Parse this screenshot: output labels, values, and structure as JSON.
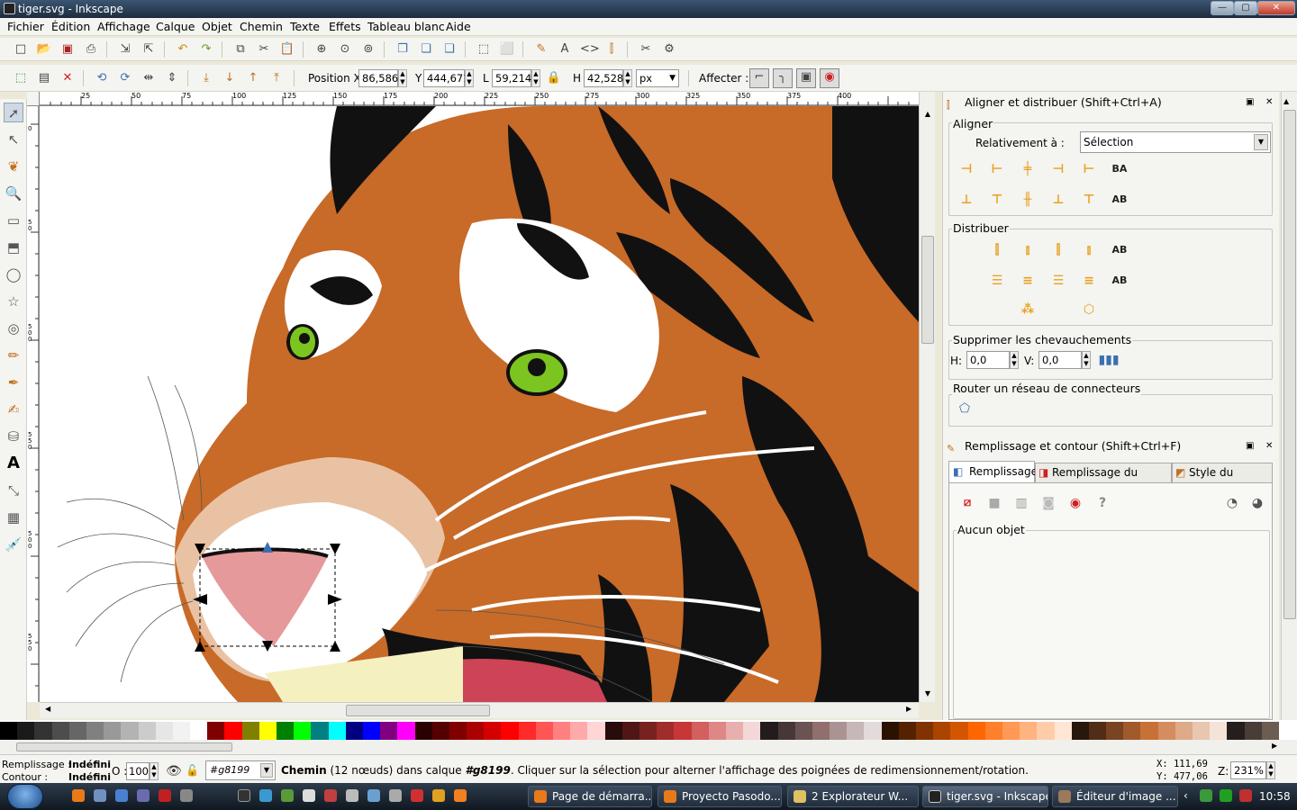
{
  "window": {
    "title": "tiger.svg - Inkscape",
    "minimize": "—",
    "maximize": "▢",
    "close": "✕"
  },
  "menu": [
    "Fichier",
    "Édition",
    "Affichage",
    "Calque",
    "Objet",
    "Chemin",
    "Texte",
    "Effets",
    "Tableau blanc",
    "Aide"
  ],
  "select_toolbar": {
    "x_label": "Position X",
    "x_value": "86,586",
    "y_label": "Y",
    "y_value": "444,671",
    "w_label": "L",
    "w_value": "59,214",
    "h_label": "H",
    "h_value": "42,528",
    "unit": "px",
    "affect_label": "Affecter :"
  },
  "ruler_h": [
    "25",
    "50",
    "75",
    "100",
    "125",
    "150",
    "175",
    "200",
    "225",
    "250",
    "275",
    "300",
    "325",
    "350",
    "375",
    "400"
  ],
  "ruler_v": [
    "0",
    "50",
    "500",
    "550",
    "500",
    "550",
    "500",
    "550"
  ],
  "align_panel": {
    "title": "Aligner et distribuer (Shift+Ctrl+A)",
    "align_label": "Aligner",
    "relative_label": "Relativement à :",
    "relative_value": "Sélection",
    "distribute_label": "Distribuer",
    "overlap_label": "Supprimer les chevauchements",
    "h_label": "H:",
    "h_value": "0,0",
    "v_label": "V:",
    "v_value": "0,0",
    "connectors_label": "Router un réseau de connecteurs"
  },
  "fill_panel": {
    "title": "Remplissage et contour (Shift+Ctrl+F)",
    "tabs": [
      "Remplissage",
      "Remplissage du contour",
      "Style du contour"
    ],
    "no_object": "Aucun objet"
  },
  "status": {
    "fill_label": "Remplissage :",
    "fill_value": "Indéfini",
    "stroke_label": "Contour :",
    "stroke_value": "Indéfini",
    "opacity_label": "O :",
    "opacity_value": "100",
    "layer": "#g8199",
    "message_bold": "Chemin",
    "message": "(12 nœuds) dans calque",
    "message_layer": "#g8199",
    "message_rest": ". Cliquer sur la sélection pour alterner l'affichage des poignées de redimensionnement/rotation.",
    "x_coord": "X: 111,69",
    "y_coord": "Y: 477,06",
    "zoom_label": "Z:",
    "zoom_value": "231%"
  },
  "taskbar": {
    "tasks": [
      "Page de démarra...",
      "Proyecto Pasodo...",
      "2 Explorateur W...",
      "tiger.svg - Inkscape",
      "Éditeur d'image ..."
    ],
    "clock": "10:58"
  },
  "palette": [
    "#000000",
    "#1a1a1a",
    "#333333",
    "#4d4d4d",
    "#666666",
    "#808080",
    "#999999",
    "#b3b3b3",
    "#cccccc",
    "#e6e6e6",
    "#f2f2f2",
    "#ffffff",
    "#800000",
    "#ff0000",
    "#808000",
    "#ffff00",
    "#008000",
    "#00ff00",
    "#008080",
    "#00ffff",
    "#000080",
    "#0000ff",
    "#800080",
    "#ff00ff",
    "#2b0000",
    "#550000",
    "#800000",
    "#aa0000",
    "#d40000",
    "#ff0000",
    "#ff2a2a",
    "#ff5555",
    "#ff8080",
    "#ffaaaa",
    "#ffd5d5",
    "#280b0b",
    "#501616",
    "#782121",
    "#a02c2c",
    "#c83737",
    "#d35f5f",
    "#de8787",
    "#e9afaf",
    "#f4d7d7",
    "#241c1c",
    "#483737",
    "#6c5353",
    "#916f6f",
    "#ac9393",
    "#c8b7b7",
    "#e3dbdb",
    "#2b1100",
    "#552200",
    "#803300",
    "#aa4400",
    "#d45500",
    "#ff6600",
    "#ff7f2a",
    "#ff9955",
    "#ffb380",
    "#ffccaa",
    "#ffe6d5",
    "#28170b",
    "#502d16",
    "#784421",
    "#a05a2c",
    "#c87137",
    "#d38d5f",
    "#deaa87",
    "#e9c6af",
    "#f4e3d7",
    "#241f1c",
    "#483e37",
    "#6c5d53"
  ]
}
